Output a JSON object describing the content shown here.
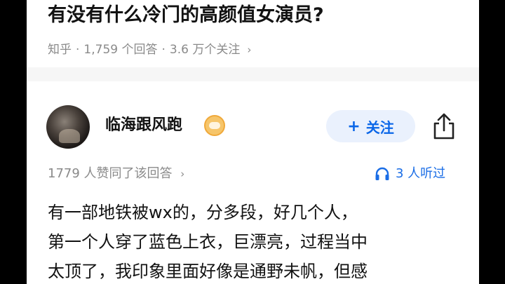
{
  "question": {
    "title": "有没有什么冷门的高颜值女演员?",
    "source": "知乎",
    "answers": "1,759 个回答",
    "followers": "3.6 万个关注",
    "separator": "·",
    "chevron": "›"
  },
  "author": {
    "name": "临海跟风跑",
    "follow_plus": "+",
    "follow_label": "关注"
  },
  "answer": {
    "approve_text": "1779 人赞同了该回答",
    "chevron": "›",
    "listen_text": "3 人听过",
    "lines": [
      "有一部地铁被wx的，分多段，好几个人，",
      "第一个人穿了蓝色上衣，巨漂亮，过程当中",
      "太顶了，我印象里面好像是通野未帆，但感"
    ]
  },
  "colors": {
    "accent": "#0a66e8",
    "follow_bg": "#eaf1fd",
    "meta_gray": "#8a8a8a",
    "divider": "#f6f6f6"
  }
}
